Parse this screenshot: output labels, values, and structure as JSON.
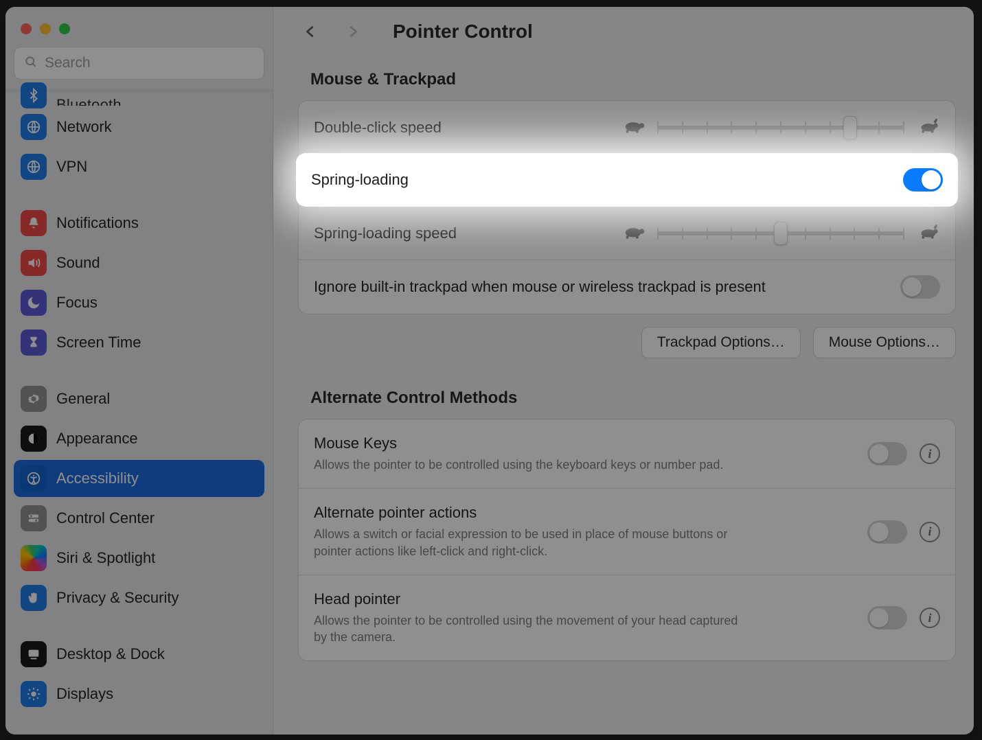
{
  "window": {
    "title": "Pointer Control"
  },
  "sidebar": {
    "search_placeholder": "Search",
    "partial_top_label": "Bluetooth",
    "items": [
      {
        "id": "network",
        "label": "Network"
      },
      {
        "id": "vpn",
        "label": "VPN"
      },
      {
        "id": "notifications",
        "label": "Notifications"
      },
      {
        "id": "sound",
        "label": "Sound"
      },
      {
        "id": "focus",
        "label": "Focus"
      },
      {
        "id": "screentime",
        "label": "Screen Time"
      },
      {
        "id": "general",
        "label": "General"
      },
      {
        "id": "appearance",
        "label": "Appearance"
      },
      {
        "id": "accessibility",
        "label": "Accessibility",
        "selected": true
      },
      {
        "id": "controlcenter",
        "label": "Control Center"
      },
      {
        "id": "siri",
        "label": "Siri & Spotlight"
      },
      {
        "id": "privacy",
        "label": "Privacy & Security"
      },
      {
        "id": "desktopdock",
        "label": "Desktop & Dock"
      },
      {
        "id": "displays",
        "label": "Displays"
      }
    ]
  },
  "main": {
    "section1_title": "Mouse & Trackpad",
    "double_click_label": "Double-click speed",
    "double_click_pos": 0.78,
    "spring_loading_label": "Spring-loading",
    "spring_loading_on": true,
    "spring_speed_label": "Spring-loading speed",
    "spring_speed_pos": 0.5,
    "ignore_trackpad_label": "Ignore built-in trackpad when mouse or wireless trackpad is present",
    "ignore_trackpad_on": false,
    "trackpad_options_btn": "Trackpad Options…",
    "mouse_options_btn": "Mouse Options…",
    "section2_title": "Alternate Control Methods",
    "mouse_keys": {
      "title": "Mouse Keys",
      "sub": "Allows the pointer to be controlled using the keyboard keys or number pad.",
      "on": false
    },
    "alt_pointer": {
      "title": "Alternate pointer actions",
      "sub": "Allows a switch or facial expression to be used in place of mouse buttons or pointer actions like left-click and right-click.",
      "on": false
    },
    "head_pointer": {
      "title": "Head pointer",
      "sub": "Allows the pointer to be controlled using the movement of your head captured by the camera.",
      "on": false
    }
  }
}
